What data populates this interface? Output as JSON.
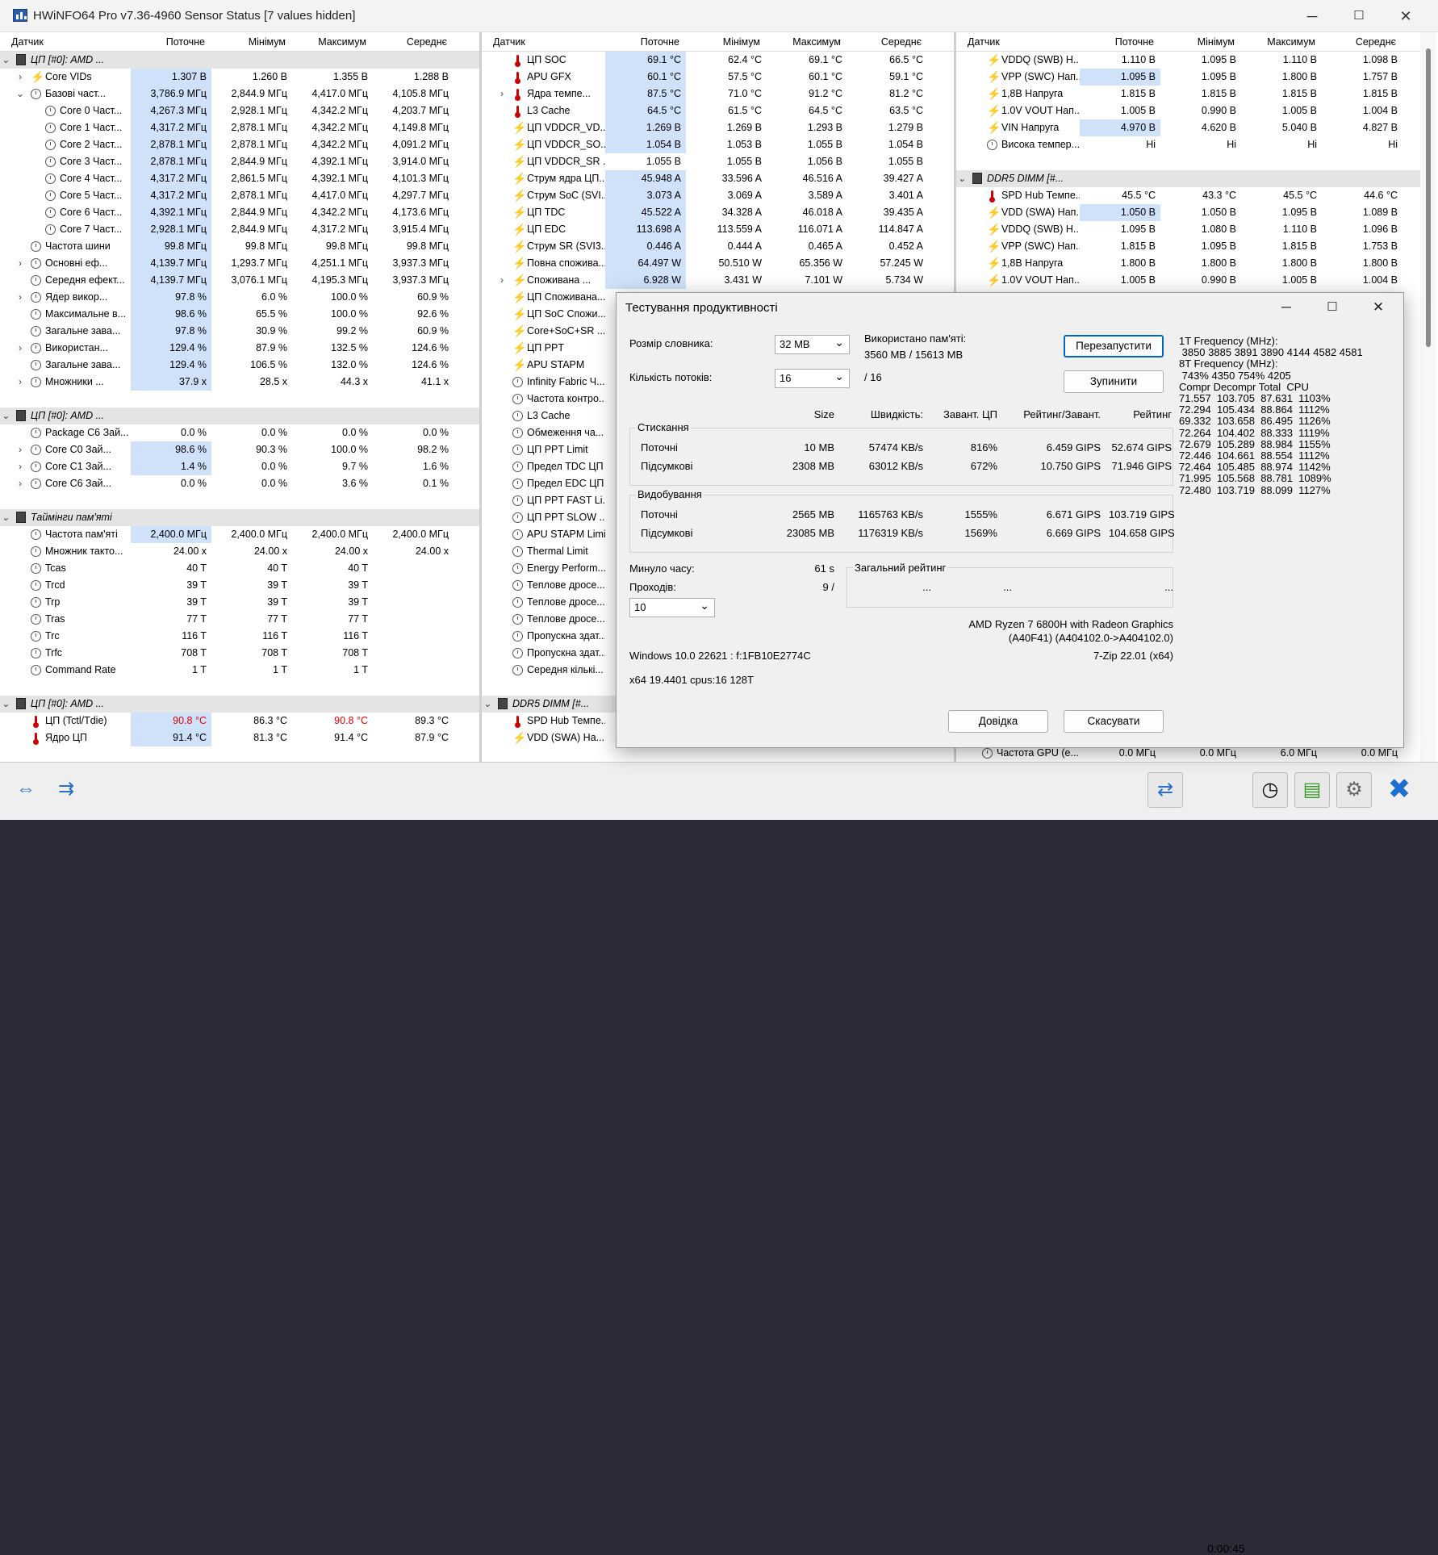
{
  "window": {
    "title": "HWiNFO64 Pro v7.36-4960 Sensor Status [7 values hidden]"
  },
  "headers": {
    "sensor": "Датчик",
    "current": "Поточне",
    "min": "Мінімум",
    "max": "Максимум",
    "avg": "Середнє"
  },
  "panel1": [
    {
      "t": "grp",
      "exp": "v",
      "icon": "chip",
      "name": "ЦП [#0]: AMD ...",
      "ind": 0
    },
    {
      "exp": ">",
      "icon": "bolt",
      "name": "Core VIDs",
      "cur": "1.307 В",
      "min": "1.260 В",
      "max": "1.355 В",
      "avg": "1.288 В",
      "hl": true,
      "ind": 1
    },
    {
      "exp": "v",
      "icon": "clock",
      "name": "Базові част...",
      "cur": "3,786.9 МГц",
      "min": "2,844.9 МГц",
      "max": "4,417.0 МГц",
      "avg": "4,105.8 МГц",
      "hl": true,
      "ind": 1
    },
    {
      "icon": "clock",
      "name": "Core 0 Част...",
      "cur": "4,267.3 МГц",
      "min": "2,928.1 МГц",
      "max": "4,342.2 МГц",
      "avg": "4,203.7 МГц",
      "hl": true,
      "ind": 2
    },
    {
      "icon": "clock",
      "name": "Core 1 Част...",
      "cur": "4,317.2 МГц",
      "min": "2,878.1 МГц",
      "max": "4,342.2 МГц",
      "avg": "4,149.8 МГц",
      "hl": true,
      "ind": 2
    },
    {
      "icon": "clock",
      "name": "Core 2 Част...",
      "cur": "2,878.1 МГц",
      "min": "2,878.1 МГц",
      "max": "4,342.2 МГц",
      "avg": "4,091.2 МГц",
      "hl": true,
      "ind": 2
    },
    {
      "icon": "clock",
      "name": "Core 3 Част...",
      "cur": "2,878.1 МГц",
      "min": "2,844.9 МГц",
      "max": "4,392.1 МГц",
      "avg": "3,914.0 МГц",
      "hl": true,
      "ind": 2
    },
    {
      "icon": "clock",
      "name": "Core 4 Част...",
      "cur": "4,317.2 МГц",
      "min": "2,861.5 МГц",
      "max": "4,392.1 МГц",
      "avg": "4,101.3 МГц",
      "hl": true,
      "ind": 2
    },
    {
      "icon": "clock",
      "name": "Core 5 Част...",
      "cur": "4,317.2 МГц",
      "min": "2,878.1 МГц",
      "max": "4,417.0 МГц",
      "avg": "4,297.7 МГц",
      "hl": true,
      "ind": 2
    },
    {
      "icon": "clock",
      "name": "Core 6 Част...",
      "cur": "4,392.1 МГц",
      "min": "2,844.9 МГц",
      "max": "4,342.2 МГц",
      "avg": "4,173.6 МГц",
      "hl": true,
      "ind": 2
    },
    {
      "icon": "clock",
      "name": "Core 7 Част...",
      "cur": "2,928.1 МГц",
      "min": "2,844.9 МГц",
      "max": "4,317.2 МГц",
      "avg": "3,915.4 МГц",
      "hl": true,
      "ind": 2
    },
    {
      "icon": "clock",
      "name": "Частота шини",
      "cur": "99.8 МГц",
      "min": "99.8 МГц",
      "max": "99.8 МГц",
      "avg": "99.8 МГц",
      "hl": true,
      "ind": 1
    },
    {
      "exp": ">",
      "icon": "clock",
      "name": "Основні еф...",
      "cur": "4,139.7 МГц",
      "min": "1,293.7 МГц",
      "max": "4,251.1 МГц",
      "avg": "3,937.3 МГц",
      "hl": true,
      "ind": 1
    },
    {
      "icon": "clock",
      "name": "Середня ефект...",
      "cur": "4,139.7 МГц",
      "min": "3,076.1 МГц",
      "max": "4,195.3 МГц",
      "avg": "3,937.3 МГц",
      "hl": true,
      "ind": 1
    },
    {
      "exp": ">",
      "icon": "clock",
      "name": "Ядер викор...",
      "cur": "97.8 %",
      "min": "6.0 %",
      "max": "100.0 %",
      "avg": "60.9 %",
      "hl": true,
      "ind": 1
    },
    {
      "icon": "clock",
      "name": "Максимальне в...",
      "cur": "98.6 %",
      "min": "65.5 %",
      "max": "100.0 %",
      "avg": "92.6 %",
      "hl": true,
      "ind": 1
    },
    {
      "icon": "clock",
      "name": "Загальне зава...",
      "cur": "97.8 %",
      "min": "30.9 %",
      "max": "99.2 %",
      "avg": "60.9 %",
      "hl": true,
      "ind": 1
    },
    {
      "exp": ">",
      "icon": "clock",
      "name": "Використан...",
      "cur": "129.4 %",
      "min": "87.9 %",
      "max": "132.5 %",
      "avg": "124.6 %",
      "hl": true,
      "ind": 1
    },
    {
      "icon": "clock",
      "name": "Загальне зава...",
      "cur": "129.4 %",
      "min": "106.5 %",
      "max": "132.0 %",
      "avg": "124.6 %",
      "hl": true,
      "ind": 1
    },
    {
      "exp": ">",
      "icon": "clock",
      "name": "Множники ...",
      "cur": "37.9 x",
      "min": "28.5 x",
      "max": "44.3 x",
      "avg": "41.1 x",
      "hl": true,
      "ind": 1
    },
    {
      "t": "blank"
    },
    {
      "t": "grp",
      "exp": "v",
      "icon": "chip",
      "name": "ЦП [#0]: AMD ...",
      "ind": 0
    },
    {
      "icon": "clock",
      "name": "Package C6 Зай...",
      "cur": "0.0 %",
      "min": "0.0 %",
      "max": "0.0 %",
      "avg": "0.0 %",
      "ind": 1
    },
    {
      "exp": ">",
      "icon": "clock",
      "name": "Core C0 Зай...",
      "cur": "98.6 %",
      "min": "90.3 %",
      "max": "100.0 %",
      "avg": "98.2 %",
      "hl": true,
      "ind": 1
    },
    {
      "exp": ">",
      "icon": "clock",
      "name": "Core C1 Зай...",
      "cur": "1.4 %",
      "min": "0.0 %",
      "max": "9.7 %",
      "avg": "1.6 %",
      "hl": true,
      "ind": 1
    },
    {
      "exp": ">",
      "icon": "clock",
      "name": "Core C6 Зай...",
      "cur": "0.0 %",
      "min": "0.0 %",
      "max": "3.6 %",
      "avg": "0.1 %",
      "ind": 1
    },
    {
      "t": "blank"
    },
    {
      "t": "grp",
      "exp": "v",
      "icon": "chip",
      "name": "Таймінги пам'яті",
      "ind": 0
    },
    {
      "icon": "clock",
      "name": "Частота пам'яті",
      "cur": "2,400.0 МГц",
      "min": "2,400.0 МГц",
      "max": "2,400.0 МГц",
      "avg": "2,400.0 МГц",
      "hl": true,
      "ind": 1
    },
    {
      "icon": "clock",
      "name": "Множник такто...",
      "cur": "24.00 x",
      "min": "24.00 x",
      "max": "24.00 x",
      "avg": "24.00 x",
      "ind": 1
    },
    {
      "icon": "clock",
      "name": "Tcas",
      "cur": "40 T",
      "min": "40 T",
      "max": "40 T",
      "avg": "",
      "ind": 1
    },
    {
      "icon": "clock",
      "name": "Trcd",
      "cur": "39 T",
      "min": "39 T",
      "max": "39 T",
      "avg": "",
      "ind": 1
    },
    {
      "icon": "clock",
      "name": "Trp",
      "cur": "39 T",
      "min": "39 T",
      "max": "39 T",
      "avg": "",
      "ind": 1
    },
    {
      "icon": "clock",
      "name": "Tras",
      "cur": "77 T",
      "min": "77 T",
      "max": "77 T",
      "avg": "",
      "ind": 1
    },
    {
      "icon": "clock",
      "name": "Trc",
      "cur": "116 T",
      "min": "116 T",
      "max": "116 T",
      "avg": "",
      "ind": 1
    },
    {
      "icon": "clock",
      "name": "Trfc",
      "cur": "708 T",
      "min": "708 T",
      "max": "708 T",
      "avg": "",
      "ind": 1
    },
    {
      "icon": "clock",
      "name": "Command Rate",
      "cur": "1 T",
      "min": "1 T",
      "max": "1 T",
      "avg": "",
      "ind": 1
    },
    {
      "t": "blank"
    },
    {
      "t": "grp",
      "exp": "v",
      "icon": "chip",
      "name": "ЦП [#0]: AMD ...",
      "ind": 0
    },
    {
      "icon": "therm",
      "name": "ЦП (Tctl/Tdie)",
      "cur": "90.8 °C",
      "min": "86.3 °C",
      "max": "90.8 °C",
      "avg": "89.3 °C",
      "hl": true,
      "red": true,
      "ind": 1
    },
    {
      "icon": "therm",
      "name": "Ядро ЦП",
      "cur": "91.4 °C",
      "min": "81.3 °C",
      "max": "91.4 °C",
      "avg": "87.9 °C",
      "hl": true,
      "ind": 1
    }
  ],
  "panel2": [
    {
      "icon": "therm",
      "name": "ЦП SOC",
      "cur": "69.1 °C",
      "min": "62.4 °C",
      "max": "69.1 °C",
      "avg": "66.5 °C",
      "hl": true,
      "ind": 1
    },
    {
      "icon": "therm",
      "name": "APU GFX",
      "cur": "60.1 °C",
      "min": "57.5 °C",
      "max": "60.1 °C",
      "avg": "59.1 °C",
      "hl": true,
      "ind": 1
    },
    {
      "exp": ">",
      "icon": "therm",
      "name": "Ядра темпе...",
      "cur": "87.5 °C",
      "min": "71.0 °C",
      "max": "91.2 °C",
      "avg": "81.2 °C",
      "hl": true,
      "ind": 1
    },
    {
      "icon": "therm",
      "name": "L3 Cache",
      "cur": "64.5 °C",
      "min": "61.5 °C",
      "max": "64.5 °C",
      "avg": "63.5 °C",
      "hl": true,
      "ind": 1
    },
    {
      "icon": "bolt",
      "name": "ЦП VDDCR_VD...",
      "cur": "1.269 В",
      "min": "1.269 В",
      "max": "1.293 В",
      "avg": "1.279 В",
      "hl": true,
      "ind": 1
    },
    {
      "icon": "bolt",
      "name": "ЦП VDDCR_SO...",
      "cur": "1.054 В",
      "min": "1.053 В",
      "max": "1.055 В",
      "avg": "1.054 В",
      "hl": true,
      "ind": 1
    },
    {
      "icon": "bolt",
      "name": "ЦП VDDCR_SR ...",
      "cur": "1.055 В",
      "min": "1.055 В",
      "max": "1.056 В",
      "avg": "1.055 В",
      "ind": 1
    },
    {
      "icon": "bolt",
      "name": "Струм ядра ЦП...",
      "cur": "45.948 A",
      "min": "33.596 A",
      "max": "46.516 A",
      "avg": "39.427 A",
      "hl": true,
      "ind": 1
    },
    {
      "icon": "bolt",
      "name": "Струм SoC (SVI...",
      "cur": "3.073 A",
      "min": "3.069 A",
      "max": "3.589 A",
      "avg": "3.401 A",
      "hl": true,
      "ind": 1
    },
    {
      "icon": "bolt",
      "name": "ЦП TDC",
      "cur": "45.522 A",
      "min": "34.328 A",
      "max": "46.018 A",
      "avg": "39.435 A",
      "hl": true,
      "ind": 1
    },
    {
      "icon": "bolt",
      "name": "ЦП EDC",
      "cur": "113.698 A",
      "min": "113.559 A",
      "max": "116.071 A",
      "avg": "114.847 A",
      "hl": true,
      "ind": 1
    },
    {
      "icon": "bolt",
      "name": "Струм SR (SVI3...",
      "cur": "0.446 A",
      "min": "0.444 A",
      "max": "0.465 A",
      "avg": "0.452 A",
      "hl": true,
      "ind": 1
    },
    {
      "icon": "bolt",
      "name": "Повна спожива...",
      "cur": "64.497 W",
      "min": "50.510 W",
      "max": "65.356 W",
      "avg": "57.245 W",
      "hl": true,
      "ind": 1
    },
    {
      "exp": ">",
      "icon": "bolt",
      "name": "Споживана ...",
      "cur": "6.928 W",
      "min": "3.431 W",
      "max": "7.101 W",
      "avg": "5.734 W",
      "hl": true,
      "ind": 1
    },
    {
      "icon": "bolt",
      "name": "ЦП Споживана...",
      "ind": 1
    },
    {
      "icon": "bolt",
      "name": "ЦП SoC Спожи...",
      "ind": 1
    },
    {
      "icon": "bolt",
      "name": "Core+SoC+SR ...",
      "ind": 1
    },
    {
      "icon": "bolt",
      "name": "ЦП PPT",
      "ind": 1
    },
    {
      "icon": "bolt",
      "name": "APU STAPM",
      "ind": 1
    },
    {
      "icon": "clock",
      "name": "Infinity Fabric Ч...",
      "ind": 1
    },
    {
      "icon": "clock",
      "name": "Частота контро...",
      "ind": 1
    },
    {
      "icon": "clock",
      "name": "L3 Cache",
      "ind": 1
    },
    {
      "icon": "clock",
      "name": "Обмеження ча...",
      "ind": 1
    },
    {
      "icon": "clock",
      "name": "ЦП PPT Limit",
      "ind": 1
    },
    {
      "icon": "clock",
      "name": "Предел TDC ЦП",
      "ind": 1
    },
    {
      "icon": "clock",
      "name": "Предел EDC ЦП",
      "ind": 1
    },
    {
      "icon": "clock",
      "name": "ЦП PPT FAST Li...",
      "ind": 1
    },
    {
      "icon": "clock",
      "name": "ЦП PPT SLOW ...",
      "ind": 1
    },
    {
      "icon": "clock",
      "name": "APU STAPM Limit",
      "ind": 1
    },
    {
      "icon": "clock",
      "name": "Thermal Limit",
      "ind": 1
    },
    {
      "icon": "clock",
      "name": "Energy Perform...",
      "ind": 1
    },
    {
      "icon": "clock",
      "name": "Теплове дросе...",
      "ind": 1
    },
    {
      "icon": "clock",
      "name": "Теплове дросе...",
      "ind": 1
    },
    {
      "icon": "clock",
      "name": "Теплове дросе...",
      "ind": 1
    },
    {
      "icon": "clock",
      "name": "Пропускна здат...",
      "ind": 1
    },
    {
      "icon": "clock",
      "name": "Пропускна здат...",
      "ind": 1
    },
    {
      "icon": "clock",
      "name": "Середня кількі...",
      "ind": 1
    },
    {
      "t": "blank"
    },
    {
      "t": "grp",
      "exp": "v",
      "icon": "chip",
      "name": "DDR5 DIMM [#...",
      "ind": 0
    },
    {
      "icon": "therm",
      "name": "SPD Hub Темпе...",
      "ind": 1
    },
    {
      "icon": "bolt",
      "name": "VDD (SWA) На...",
      "ind": 1
    }
  ],
  "panel3": [
    {
      "icon": "bolt",
      "name": "VDDQ (SWB) Н...",
      "cur": "1.110 В",
      "min": "1.095 В",
      "max": "1.110 В",
      "avg": "1.098 В",
      "ind": 1
    },
    {
      "icon": "bolt",
      "name": "VPP (SWC) Нап...",
      "cur": "1.095 В",
      "min": "1.095 В",
      "max": "1.800 В",
      "avg": "1.757 В",
      "hl": true,
      "ind": 1
    },
    {
      "icon": "bolt",
      "name": "1,8В Напруга",
      "cur": "1.815 В",
      "min": "1.815 В",
      "max": "1.815 В",
      "avg": "1.815 В",
      "ind": 1
    },
    {
      "icon": "bolt",
      "name": "1.0V VOUT Нап...",
      "cur": "1.005 В",
      "min": "0.990 В",
      "max": "1.005 В",
      "avg": "1.004 В",
      "ind": 1
    },
    {
      "icon": "bolt",
      "name": "VIN Напруга",
      "cur": "4.970 В",
      "min": "4.620 В",
      "max": "5.040 В",
      "avg": "4.827 В",
      "hl": true,
      "ind": 1
    },
    {
      "icon": "clock",
      "name": "Висока темпер...",
      "cur": "Hi",
      "min": "Hi",
      "max": "Hi",
      "avg": "Hi",
      "ind": 1
    },
    {
      "t": "blank"
    },
    {
      "t": "grp",
      "exp": "v",
      "icon": "chip",
      "name": "DDR5 DIMM [#...",
      "ind": 0
    },
    {
      "icon": "therm",
      "name": "SPD Hub Темпе...",
      "cur": "45.5 °C",
      "min": "43.3 °C",
      "max": "45.5 °C",
      "avg": "44.6 °C",
      "ind": 1
    },
    {
      "icon": "bolt",
      "name": "VDD (SWA) Нап...",
      "cur": "1.050 В",
      "min": "1.050 В",
      "max": "1.095 В",
      "avg": "1.089 В",
      "hl": true,
      "ind": 1
    },
    {
      "icon": "bolt",
      "name": "VDDQ (SWB) Н...",
      "cur": "1.095 В",
      "min": "1.080 В",
      "max": "1.110 В",
      "avg": "1.096 В",
      "ind": 1
    },
    {
      "icon": "bolt",
      "name": "VPP (SWC) Нап...",
      "cur": "1.815 В",
      "min": "1.095 В",
      "max": "1.815 В",
      "avg": "1.753 В",
      "ind": 1
    },
    {
      "icon": "bolt",
      "name": "1,8В Напруга",
      "cur": "1.800 В",
      "min": "1.800 В",
      "max": "1.800 В",
      "avg": "1.800 В",
      "ind": 1
    },
    {
      "icon": "bolt",
      "name": "1.0V VOUT Нап...",
      "cur": "1.005 В",
      "min": "0.990 В",
      "max": "1.005 В",
      "avg": "1.004 В",
      "ind": 1
    }
  ],
  "panel3_bottom": {
    "name": "Частота GPU (е...",
    "cur": "0.0 МГц",
    "min": "0.0 МГц",
    "max": "6.0 МГц",
    "avg": "0.0 МГц"
  },
  "bottom": {
    "timer": "0:00:45"
  },
  "dialog": {
    "title": "Тестування продуктивності",
    "dict_size_label": "Розмір словника:",
    "dict_size_value": "32 MB",
    "threads_label": "Кількість потоків:",
    "threads_value": "16",
    "threads_of": "/ 16",
    "mem_used_label": "Використано пам'яті:",
    "mem_used_value": "3560 MB / 15613 MB",
    "restart_btn": "Перезапустити",
    "stop_btn": "Зупинити",
    "col_size": "Size",
    "col_speed": "Швидкість:",
    "col_load": "Завант. ЦП",
    "col_rating_load": "Рейтинг/Завант.",
    "col_rating": "Рейтинг",
    "compress_label": "Стискання",
    "decompress_label": "Видобування",
    "current_label": "Поточні",
    "total_label": "Підсумкові",
    "compress_cur": {
      "size": "10 MB",
      "speed": "57474 KB/s",
      "load": "816%",
      "rl": "6.459 GIPS",
      "r": "52.674 GIPS"
    },
    "compress_tot": {
      "size": "2308 MB",
      "speed": "63012 KB/s",
      "load": "672%",
      "rl": "10.750 GIPS",
      "r": "71.946 GIPS"
    },
    "decomp_cur": {
      "size": "2565 MB",
      "speed": "1165763 KB/s",
      "load": "1555%",
      "rl": "6.671 GIPS",
      "r": "103.719 GIPS"
    },
    "decomp_tot": {
      "size": "23085 MB",
      "speed": "1176319 KB/s",
      "load": "1569%",
      "rl": "6.669 GIPS",
      "r": "104.658 GIPS"
    },
    "elapsed_label": "Минуло часу:",
    "elapsed_value": "61 s",
    "passes_label": "Проходів:",
    "passes_value": "9 /",
    "passes_combo": "10",
    "overall_label": "Загальний рейтинг",
    "overall_dots": [
      "...",
      "...",
      "..."
    ],
    "cpu_name": "AMD Ryzen 7 6800H with Radeon Graphics",
    "cpu_id": "(A40F41) (A404102.0->A404102.0)",
    "os": "Windows 10.0 22621 : f:1FB10E2774C",
    "zip_ver": "7-Zip 22.01 (x64)",
    "arch": "x64 19.4401 cpus:16 128T",
    "help_btn": "Довідка",
    "cancel_btn": "Скасувати",
    "freq_lines": [
      "1T Frequency (MHz):",
      " 3850 3885 3891 3890 4144 4582 4581",
      "8T Frequency (MHz):",
      " 743% 4350 754% 4205",
      "Compr Decompr Total  CPU",
      "71.557  103.705  87.631  1103%",
      "72.294  105.434  88.864  1112%",
      "69.332  103.658  86.495  1126%",
      "72.264  104.402  88.333  1119%",
      "72.679  105.289  88.984  1155%",
      "72.446  104.661  88.554  1112%",
      "72.464  105.485  88.974  1142%",
      "71.995  105.568  88.781  1089%",
      "72.480  103.719  88.099  1127%"
    ]
  }
}
